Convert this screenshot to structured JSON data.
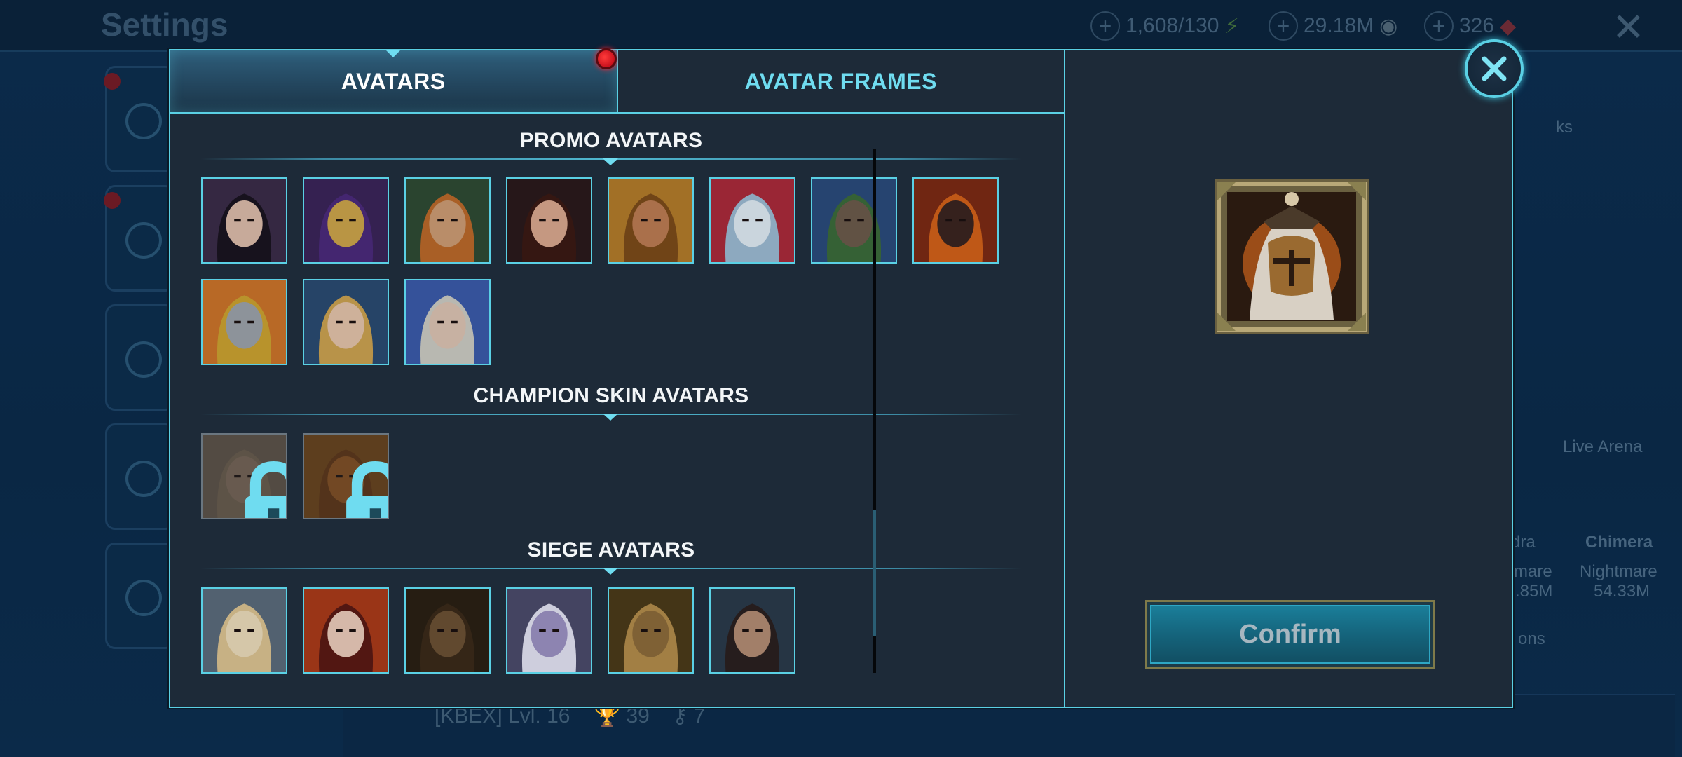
{
  "background": {
    "title": "Settings",
    "resources": [
      {
        "value": "1,608/130",
        "icon": "energy-icon"
      },
      {
        "value": "29.18M",
        "icon": "silver-icon"
      },
      {
        "value": "326",
        "icon": "gem-icon"
      }
    ],
    "right_labels": {
      "arena": "Live Arena",
      "hydra": "dra",
      "chimera": "Chimera",
      "hydra_diff": "mare",
      "chimera_diff": "Nightmare",
      "hydra_dmg": ".85M",
      "chimera_dmg": "54.33M",
      "tasks": "ks",
      "collections": "ons"
    },
    "clan": "[KBEX] Lvl. 16",
    "clan_stat_1": "39",
    "clan_stat_2": "7"
  },
  "tabs": {
    "avatars": "AVATARS",
    "frames": "AVATAR FRAMES"
  },
  "sections": {
    "promo": "PROMO AVATARS",
    "skins": "CHAMPION SKIN AVATARS",
    "siege": "SIEGE AVATARS"
  },
  "promo_avatars": [
    {
      "name": "dark-haired-woman",
      "bg": "#3a2c48",
      "face": "#d8b9a8",
      "hair": "#1a1420"
    },
    {
      "name": "golden-skull-hood",
      "bg": "#3a2458",
      "face": "#c9a24a",
      "hair": "#4a2a7a"
    },
    {
      "name": "tiara-warrior",
      "bg": "#2e4a34",
      "face": "#c99a72",
      "hair": "#b8682a"
    },
    {
      "name": "red-cloak-woman",
      "bg": "#2a1a1c",
      "face": "#d6a58c",
      "hair": "#3a1a14"
    },
    {
      "name": "bearded-pirate",
      "bg": "#b07a2a",
      "face": "#b97a52",
      "hair": "#7a4a1a"
    },
    {
      "name": "frost-beast",
      "bg": "#a82a3a",
      "face": "#dce8f0",
      "hair": "#9ab8d0"
    },
    {
      "name": "tree-ent",
      "bg": "#2a4a7a",
      "face": "#6a5a4a",
      "hair": "#3a6a3a"
    },
    {
      "name": "fire-demon",
      "bg": "#7a2a14",
      "face": "#3a2420",
      "hair": "#d0601a"
    },
    {
      "name": "crusader-helm",
      "bg": "#c8722a",
      "face": "#9aa0a8",
      "hair": "#c8a030"
    },
    {
      "name": "elf-princess",
      "bg": "#2a4a70",
      "face": "#e0c0a8",
      "hair": "#c8a050"
    },
    {
      "name": "tattooed-warrior",
      "bg": "#3a5aa8",
      "face": "#d8c0b0",
      "hair": "#c8c8c0"
    }
  ],
  "skin_avatars": [
    {
      "name": "locked-skin-woman",
      "bg": "#6a5e52",
      "face": "#8a7664",
      "hair": "#7a6a58",
      "locked": true
    },
    {
      "name": "locked-skin-ape",
      "bg": "#7a4a1a",
      "face": "#9a5a22",
      "hair": "#6a3a14",
      "locked": true
    }
  ],
  "siege_avatars": [
    {
      "name": "lion-king",
      "bg": "#5a6a7a",
      "face": "#e8d8b8",
      "hair": "#d8c090"
    },
    {
      "name": "crowned-queen",
      "bg": "#a83a1a",
      "face": "#e8c8b8",
      "hair": "#5a1a14"
    },
    {
      "name": "orc-brute",
      "bg": "#2a2014",
      "face": "#6a5034",
      "hair": "#3a2a1a"
    },
    {
      "name": "dark-elf",
      "bg": "#4a4a6a",
      "face": "#9a90c0",
      "hair": "#e0e0f0"
    },
    {
      "name": "roaring-ape",
      "bg": "#4a3a1a",
      "face": "#8a6a3a",
      "hair": "#b08a4a"
    },
    {
      "name": "scarred-warrior",
      "bg": "#2a3a4a",
      "face": "#b08a72",
      "hair": "#2a2020"
    }
  ],
  "preview": {
    "name": "hooded-knight-preview"
  },
  "confirm_label": "Confirm"
}
